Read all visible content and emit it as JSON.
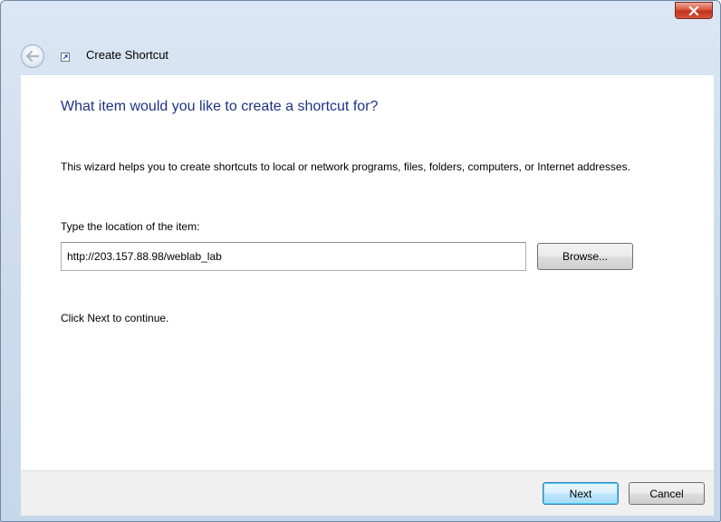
{
  "window": {
    "title": "Create Shortcut"
  },
  "icons": {
    "close": "close-icon",
    "back": "back-arrow-icon",
    "shortcut": "shortcut-icon"
  },
  "main": {
    "heading": "What item would you like to create a shortcut for?",
    "description": "This wizard helps you to create shortcuts to local or network programs, files, folders, computers, or Internet addresses.",
    "location_label": "Type the location of the item:",
    "location_value": "http://203.157.88.98/weblab_lab",
    "browse_label": "Browse...",
    "continue_text": "Click Next to continue."
  },
  "footer": {
    "next_label": "Next",
    "cancel_label": "Cancel"
  }
}
